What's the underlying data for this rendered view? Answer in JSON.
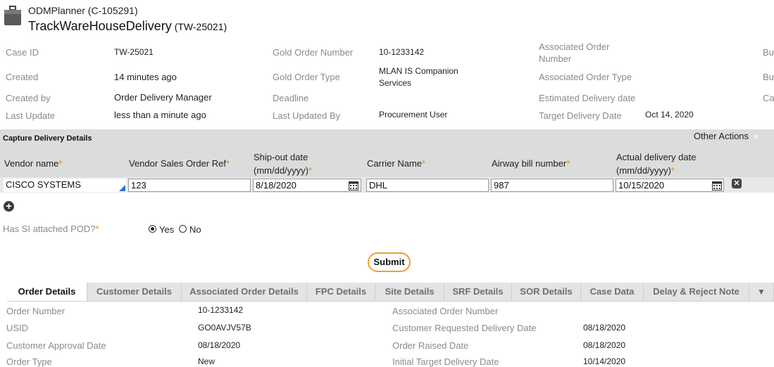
{
  "header": {
    "app": "ODMPlanner (C-105291)",
    "title": "TrackWareHouseDelivery",
    "title_id": "(TW-25021)"
  },
  "summary": {
    "case_id_label": "Case ID",
    "case_id": "TW-25021",
    "created_label": "Created",
    "created": "14 minutes ago",
    "created_by_label": "Created by",
    "created_by": "Order Delivery Manager",
    "last_update_label": "Last Update",
    "last_update": "less than a minute ago",
    "gold_order_number_label": "Gold Order Number",
    "gold_order_number": "10-1233142",
    "gold_order_type_label": "Gold Order Type",
    "gold_order_type": "MLAN IS Companion Services",
    "deadline_label": "Deadline",
    "last_updated_by_label": "Last Updated By",
    "last_updated_by": "Procurement User",
    "assoc_order_number_label": "Associated Order Number",
    "assoc_order_type_label": "Associated Order Type",
    "est_delivery_label": "Estimated Delivery date",
    "target_delivery_label": "Target Delivery Date",
    "target_delivery": "Oct 14, 2020",
    "cut1": "Bu",
    "cut2": "Bu",
    "cut3": "Ca"
  },
  "capture": {
    "title": "Capture Delivery Details",
    "other_actions": "Other Actions",
    "required_mark": "*",
    "columns": {
      "vendor_name": "Vendor name",
      "vendor_sales_ref": "Vendor Sales Order Ref",
      "ship_out_1": "Ship-out date",
      "ship_out_2": "(mm/dd/yyyy)",
      "carrier": "Carrier Name",
      "airway": "Airway bill number",
      "actual_1": "Actual delivery date",
      "actual_2": "(mm/dd/yyyy)"
    },
    "row": {
      "vendor_name": "CISCO SYSTEMS",
      "vendor_sales_ref": "123",
      "ship_out": "8/18/2020",
      "carrier": "DHL",
      "airway": "987",
      "actual_delivery": "10/15/2020"
    },
    "delete_glyph": "✕",
    "add_glyph": "+"
  },
  "pod": {
    "question": "Has SI attached POD?",
    "yes": "Yes",
    "no": "No",
    "selected": "Yes"
  },
  "submit_label": "Submit",
  "tabs": [
    {
      "label": "Order Details",
      "active": true
    },
    {
      "label": "Customer Details"
    },
    {
      "label": "Associated Order Details"
    },
    {
      "label": "FPC Details"
    },
    {
      "label": "Site Details"
    },
    {
      "label": "SRF Details"
    },
    {
      "label": "SOR Details"
    },
    {
      "label": "Case Data"
    },
    {
      "label": "Delay & Reject Note"
    }
  ],
  "tab_more": "▼",
  "order_details": {
    "order_number_label": "Order Number",
    "order_number": "10-1233142",
    "usid_label": "USID",
    "usid": "GO0AVJV57B",
    "cust_approval_label": "Customer Approval Date",
    "cust_approval": "08/18/2020",
    "order_type_label": "Order Type",
    "order_type": "New",
    "assoc_order_number_label": "Associated Order Number",
    "cust_req_delivery_label": "Customer Requested Delivery Date",
    "cust_req_delivery": "08/18/2020",
    "order_raised_label": "Order Raised Date",
    "order_raised": "08/18/2020",
    "initial_target_label": "Initial Target Delivery Date",
    "initial_target": "10/14/2020"
  }
}
